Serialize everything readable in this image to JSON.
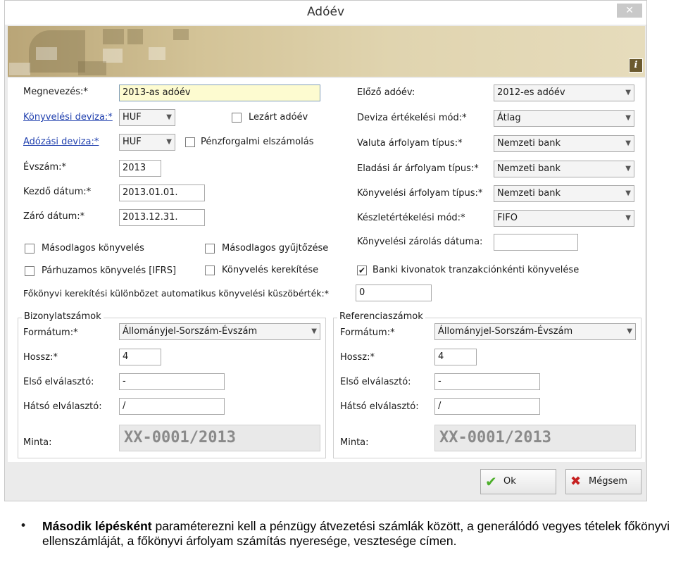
{
  "window": {
    "title": "Adóév",
    "close_glyph": "✕",
    "info_glyph": "i"
  },
  "left": {
    "name_label": "Megnevezés:*",
    "name_value": "2013-as adóév",
    "accounting_currency_label": "Könyvelési deviza:*",
    "accounting_currency_value": "HUF",
    "closed_year_label": "Lezárt adóév",
    "tax_currency_label": "Adózási deviza:*",
    "tax_currency_value": "HUF",
    "cash_accounting_label": "Pénzforgalmi elszámolás",
    "year_label": "Évszám:*",
    "year_value": "2013",
    "start_date_label": "Kezdő dátum:*",
    "start_date_value": "2013.01.01.",
    "end_date_label": "Záró dátum:*",
    "end_date_value": "2013.12.31.",
    "secondary_accounting_label": "Másodlagos könyvelés",
    "secondary_collection_label": "Másodlagos gyűjtőzése",
    "parallel_accounting_label": "Párhuzamos könyvelés [IFRS]",
    "rounding_label": "Könyvelés kerekítése",
    "threshold_label": "Főkönyvi kerekítési különbözet automatikus könyvelési küszöbérték:*",
    "threshold_value": "0"
  },
  "right": {
    "prev_year_label": "Előző adóév:",
    "prev_year_value": "2012-es adóév",
    "fx_valuation_label": "Deviza értékelési mód:*",
    "fx_valuation_value": "Átlag",
    "currency_rate_type_label": "Valuta árfolyam típus:*",
    "currency_rate_type_value": "Nemzeti bank",
    "sales_rate_type_label": "Eladási ár árfolyam típus:*",
    "sales_rate_type_value": "Nemzeti bank",
    "accounting_rate_type_label": "Könyvelési árfolyam típus:*",
    "accounting_rate_type_value": "Nemzeti bank",
    "stock_valuation_label": "Készletértékelési mód:*",
    "stock_valuation_value": "FIFO",
    "lock_date_label": "Könyvelési zárolás dátuma:",
    "lock_date_value": "",
    "bank_statement_label": "Banki kivonatok tranzakciónkénti könyvelése",
    "check_glyph": "✔"
  },
  "voucher_numbers": {
    "legend": "Bizonylatszámok",
    "format_label": "Formátum:*",
    "format_value": "Állományjel-Sorszám-Évszám",
    "length_label": "Hossz:*",
    "length_value": "4",
    "first_sep_label": "Első elválasztó:",
    "first_sep_value": "-",
    "last_sep_label": "Hátsó elválasztó:",
    "last_sep_value": "/",
    "sample_label": "Minta:",
    "sample_value": "XX-0001/2013"
  },
  "reference_numbers": {
    "legend": "Referenciaszámok",
    "format_label": "Formátum:*",
    "format_value": "Állományjel-Sorszám-Évszám",
    "length_label": "Hossz:*",
    "length_value": "4",
    "first_sep_label": "Első elválasztó:",
    "first_sep_value": "-",
    "last_sep_label": "Hátsó elválasztó:",
    "last_sep_value": "/",
    "sample_label": "Minta:",
    "sample_value": "XX-0001/2013"
  },
  "buttons": {
    "ok_label": "Ok",
    "ok_glyph": "✔",
    "cancel_label": "Mégsem",
    "cancel_glyph": "✖"
  },
  "colors": {
    "ok_icon": "#4caf2a",
    "cancel_icon": "#c62020",
    "link": "#1f3fae"
  },
  "note": {
    "bullet": "•",
    "bold": "Második lépésként",
    "text": " paraméterezni kell a pénzügy átvezetési számlák között, a generálódó vegyes tételek főkönyvi ellenszámláját, a főkönyvi árfolyam számítás nyeresége, vesztesége címen."
  }
}
